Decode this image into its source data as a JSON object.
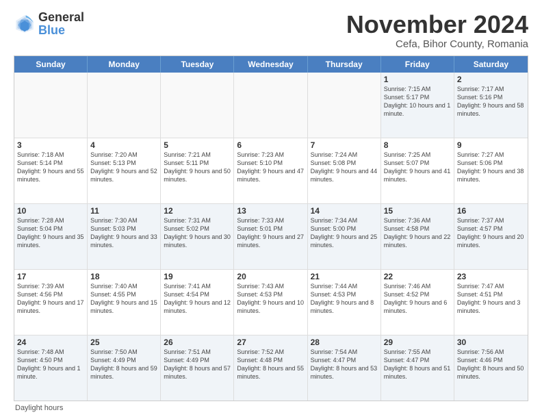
{
  "logo": {
    "general": "General",
    "blue": "Blue"
  },
  "title": "November 2024",
  "subtitle": "Cefa, Bihor County, Romania",
  "daylight_label": "Daylight hours",
  "calendar": {
    "headers": [
      "Sunday",
      "Monday",
      "Tuesday",
      "Wednesday",
      "Thursday",
      "Friday",
      "Saturday"
    ],
    "rows": [
      [
        {
          "day": "",
          "info": ""
        },
        {
          "day": "",
          "info": ""
        },
        {
          "day": "",
          "info": ""
        },
        {
          "day": "",
          "info": ""
        },
        {
          "day": "",
          "info": ""
        },
        {
          "day": "1",
          "info": "Sunrise: 7:15 AM\nSunset: 5:17 PM\nDaylight: 10 hours and 1 minute."
        },
        {
          "day": "2",
          "info": "Sunrise: 7:17 AM\nSunset: 5:16 PM\nDaylight: 9 hours and 58 minutes."
        }
      ],
      [
        {
          "day": "3",
          "info": "Sunrise: 7:18 AM\nSunset: 5:14 PM\nDaylight: 9 hours and 55 minutes."
        },
        {
          "day": "4",
          "info": "Sunrise: 7:20 AM\nSunset: 5:13 PM\nDaylight: 9 hours and 52 minutes."
        },
        {
          "day": "5",
          "info": "Sunrise: 7:21 AM\nSunset: 5:11 PM\nDaylight: 9 hours and 50 minutes."
        },
        {
          "day": "6",
          "info": "Sunrise: 7:23 AM\nSunset: 5:10 PM\nDaylight: 9 hours and 47 minutes."
        },
        {
          "day": "7",
          "info": "Sunrise: 7:24 AM\nSunset: 5:08 PM\nDaylight: 9 hours and 44 minutes."
        },
        {
          "day": "8",
          "info": "Sunrise: 7:25 AM\nSunset: 5:07 PM\nDaylight: 9 hours and 41 minutes."
        },
        {
          "day": "9",
          "info": "Sunrise: 7:27 AM\nSunset: 5:06 PM\nDaylight: 9 hours and 38 minutes."
        }
      ],
      [
        {
          "day": "10",
          "info": "Sunrise: 7:28 AM\nSunset: 5:04 PM\nDaylight: 9 hours and 35 minutes."
        },
        {
          "day": "11",
          "info": "Sunrise: 7:30 AM\nSunset: 5:03 PM\nDaylight: 9 hours and 33 minutes."
        },
        {
          "day": "12",
          "info": "Sunrise: 7:31 AM\nSunset: 5:02 PM\nDaylight: 9 hours and 30 minutes."
        },
        {
          "day": "13",
          "info": "Sunrise: 7:33 AM\nSunset: 5:01 PM\nDaylight: 9 hours and 27 minutes."
        },
        {
          "day": "14",
          "info": "Sunrise: 7:34 AM\nSunset: 5:00 PM\nDaylight: 9 hours and 25 minutes."
        },
        {
          "day": "15",
          "info": "Sunrise: 7:36 AM\nSunset: 4:58 PM\nDaylight: 9 hours and 22 minutes."
        },
        {
          "day": "16",
          "info": "Sunrise: 7:37 AM\nSunset: 4:57 PM\nDaylight: 9 hours and 20 minutes."
        }
      ],
      [
        {
          "day": "17",
          "info": "Sunrise: 7:39 AM\nSunset: 4:56 PM\nDaylight: 9 hours and 17 minutes."
        },
        {
          "day": "18",
          "info": "Sunrise: 7:40 AM\nSunset: 4:55 PM\nDaylight: 9 hours and 15 minutes."
        },
        {
          "day": "19",
          "info": "Sunrise: 7:41 AM\nSunset: 4:54 PM\nDaylight: 9 hours and 12 minutes."
        },
        {
          "day": "20",
          "info": "Sunrise: 7:43 AM\nSunset: 4:53 PM\nDaylight: 9 hours and 10 minutes."
        },
        {
          "day": "21",
          "info": "Sunrise: 7:44 AM\nSunset: 4:53 PM\nDaylight: 9 hours and 8 minutes."
        },
        {
          "day": "22",
          "info": "Sunrise: 7:46 AM\nSunset: 4:52 PM\nDaylight: 9 hours and 6 minutes."
        },
        {
          "day": "23",
          "info": "Sunrise: 7:47 AM\nSunset: 4:51 PM\nDaylight: 9 hours and 3 minutes."
        }
      ],
      [
        {
          "day": "24",
          "info": "Sunrise: 7:48 AM\nSunset: 4:50 PM\nDaylight: 9 hours and 1 minute."
        },
        {
          "day": "25",
          "info": "Sunrise: 7:50 AM\nSunset: 4:49 PM\nDaylight: 8 hours and 59 minutes."
        },
        {
          "day": "26",
          "info": "Sunrise: 7:51 AM\nSunset: 4:49 PM\nDaylight: 8 hours and 57 minutes."
        },
        {
          "day": "27",
          "info": "Sunrise: 7:52 AM\nSunset: 4:48 PM\nDaylight: 8 hours and 55 minutes."
        },
        {
          "day": "28",
          "info": "Sunrise: 7:54 AM\nSunset: 4:47 PM\nDaylight: 8 hours and 53 minutes."
        },
        {
          "day": "29",
          "info": "Sunrise: 7:55 AM\nSunset: 4:47 PM\nDaylight: 8 hours and 51 minutes."
        },
        {
          "day": "30",
          "info": "Sunrise: 7:56 AM\nSunset: 4:46 PM\nDaylight: 8 hours and 50 minutes."
        }
      ]
    ]
  },
  "colors": {
    "header_bg": "#4a7fc1",
    "shaded_bg": "#f0f4f8",
    "empty_bg": "#f9f9f9"
  }
}
